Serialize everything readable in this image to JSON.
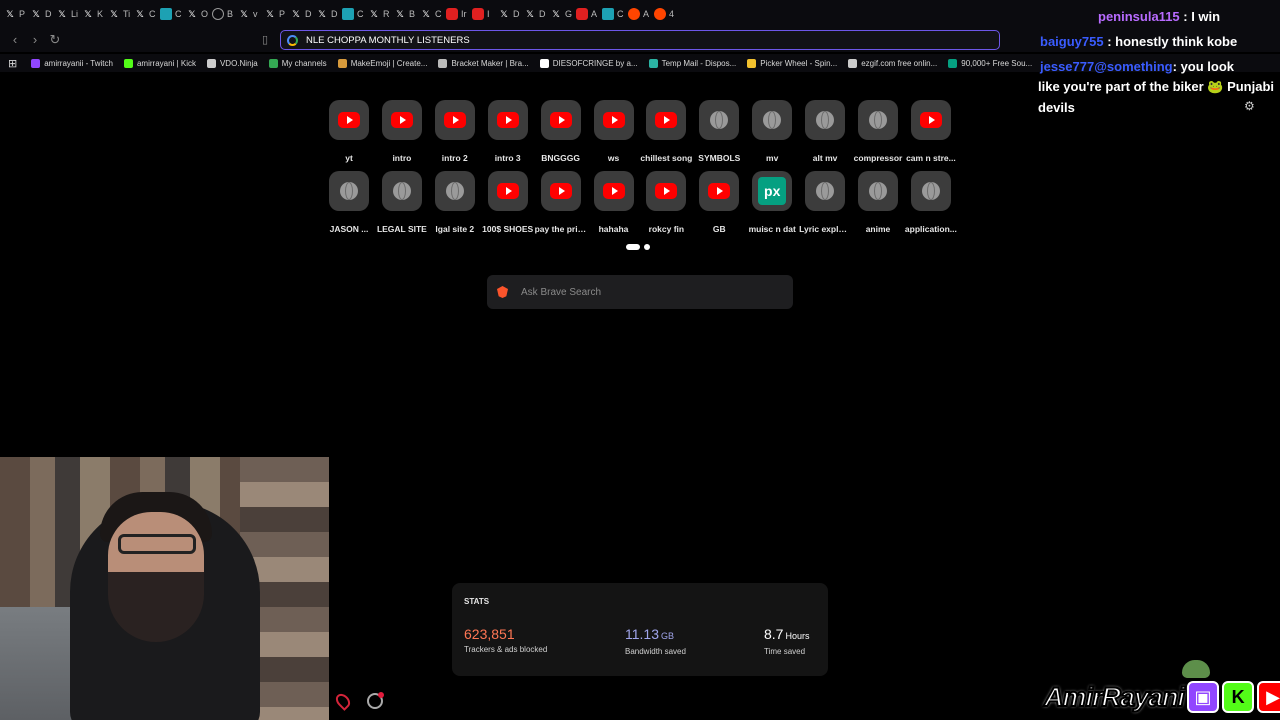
{
  "browser": {
    "tabs": [
      {
        "icon": "x-icon",
        "label": "P"
      },
      {
        "icon": "x-icon",
        "label": "D"
      },
      {
        "icon": "x-icon",
        "label": "Li"
      },
      {
        "icon": "x-icon",
        "label": "K"
      },
      {
        "icon": "x-icon",
        "label": "Ti"
      },
      {
        "icon": "x-icon",
        "label": "C"
      },
      {
        "icon": "meet-icon",
        "label": "C"
      },
      {
        "icon": "x-icon",
        "label": "O"
      },
      {
        "icon": "globe-icon",
        "label": "B"
      },
      {
        "icon": "x-icon",
        "label": "v"
      },
      {
        "icon": "x-icon",
        "label": "P"
      },
      {
        "icon": "x-icon",
        "label": "D"
      },
      {
        "icon": "x-icon",
        "label": "D"
      },
      {
        "icon": "meet-icon",
        "label": "C"
      },
      {
        "icon": "x-icon",
        "label": "R"
      },
      {
        "icon": "x-icon",
        "label": "B"
      },
      {
        "icon": "x-icon",
        "label": "C"
      },
      {
        "icon": "youtube-icon",
        "label": "Ir"
      },
      {
        "icon": "youtube-icon",
        "label": "I"
      },
      {
        "icon": "x-icon",
        "label": "D"
      },
      {
        "icon": "x-icon",
        "label": "D"
      },
      {
        "icon": "x-icon",
        "label": "G"
      },
      {
        "icon": "youtube-icon",
        "label": "A"
      },
      {
        "icon": "meet-icon",
        "label": "C"
      },
      {
        "icon": "reddit-icon",
        "label": "A"
      },
      {
        "icon": "reddit-icon",
        "label": "4"
      }
    ],
    "address_value": "NLE CHOPPA MONTHLY LISTENERS",
    "bookmarks": [
      {
        "label": "amirrayanii - Twitch",
        "color": "#9146ff"
      },
      {
        "label": "amirrayani | Kick",
        "color": "#53fc18"
      },
      {
        "label": "VDO.Ninja",
        "color": "#cccccc"
      },
      {
        "label": "My channels",
        "color": "#34a853"
      },
      {
        "label": "MakeEmoji | Create...",
        "color": "#d79a3c"
      },
      {
        "label": "Bracket Maker | Bra...",
        "color": "#bbbbbb"
      },
      {
        "label": "DIESOFCRINGE by a...",
        "color": "#ffffff"
      },
      {
        "label": "Temp Mail - Dispos...",
        "color": "#2bb3a3"
      },
      {
        "label": "Picker Wheel - Spin...",
        "color": "#f2c12e"
      },
      {
        "label": "ezgif.com free onlin...",
        "color": "#cccccc"
      },
      {
        "label": "90,000+ Free Sou...",
        "color": "#05a081"
      }
    ]
  },
  "chat": {
    "line1_user": "peninsula115",
    "line1_msg": " : I win",
    "line2_user": "baiguy755",
    "line2_msg": " : honestly think kobe",
    "line3_user": "jesse777@something",
    "line3_msg": ": you look",
    "line4": "like you're part of the biker",
    "line4b": "Punjabi",
    "line5": "devils",
    "settings_icon": "gear-icon"
  },
  "shortcuts": [
    {
      "label": "yt",
      "icon": "youtube"
    },
    {
      "label": "intro",
      "icon": "youtube"
    },
    {
      "label": "intro 2",
      "icon": "youtube"
    },
    {
      "label": "intro 3",
      "icon": "youtube"
    },
    {
      "label": "BNGGGG",
      "icon": "youtube"
    },
    {
      "label": "ws",
      "icon": "youtube"
    },
    {
      "label": "chillest song",
      "icon": "youtube"
    },
    {
      "label": "SYMBOLS",
      "icon": "globe"
    },
    {
      "label": "mv",
      "icon": "globe"
    },
    {
      "label": "alt mv",
      "icon": "globe"
    },
    {
      "label": "compressor",
      "icon": "globe"
    },
    {
      "label": "cam n stre...",
      "icon": "youtube"
    },
    {
      "label": "JASON ...",
      "icon": "globe"
    },
    {
      "label": "LEGAL SITE",
      "icon": "globe"
    },
    {
      "label": "lgal site 2",
      "icon": "globe"
    },
    {
      "label": "100$ SHOES",
      "icon": "youtube"
    },
    {
      "label": "pay the price",
      "icon": "youtube"
    },
    {
      "label": "hahaha",
      "icon": "youtube"
    },
    {
      "label": "rokcy fin",
      "icon": "youtube"
    },
    {
      "label": "GB",
      "icon": "youtube"
    },
    {
      "label": "muisc n dat",
      "icon": "px"
    },
    {
      "label": "Lyric explai...",
      "icon": "globe"
    },
    {
      "label": "anime",
      "icon": "globe"
    },
    {
      "label": "application...",
      "icon": "globe"
    }
  ],
  "search": {
    "placeholder": "Ask Brave Search"
  },
  "stats": {
    "title": "STATS",
    "trackers_value": "623,851",
    "trackers_caption": "Trackers & ads blocked",
    "trackers_color": "#ff7654",
    "bandwidth_value": "11.13",
    "bandwidth_unit": "GB",
    "bandwidth_caption": "Bandwidth saved",
    "bandwidth_color": "#a0a5eb",
    "time_value": "8.7",
    "time_unit": "Hours",
    "time_caption": "Time saved",
    "time_color": "#ffffff"
  },
  "branding": {
    "name": "AmirRayani",
    "twitch": "twitch-icon",
    "kick": "K",
    "youtube": "youtube-icon"
  },
  "accent": "#6d57e8"
}
